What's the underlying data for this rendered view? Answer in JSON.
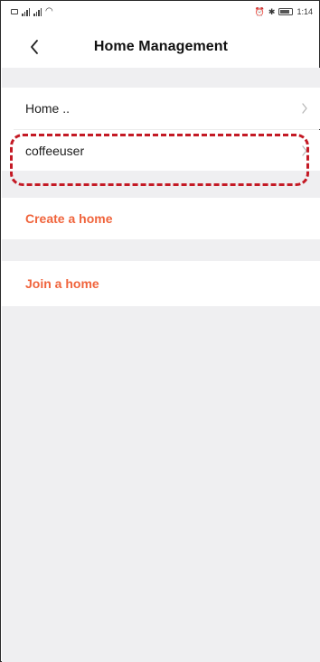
{
  "status": {
    "left_text": "4G 4G",
    "time": "1:14"
  },
  "header": {
    "title": "Home Management"
  },
  "homes": [
    {
      "label": "Home .."
    },
    {
      "label": "coffeeuser"
    }
  ],
  "actions": {
    "create": "Create a home",
    "join": "Join a home"
  },
  "colors": {
    "accent": "#f0643c",
    "highlight": "#c41a25",
    "section_gap": "#efeff1"
  },
  "icons": {
    "back": "chevron-left-icon",
    "row": "chevron-right-icon"
  }
}
